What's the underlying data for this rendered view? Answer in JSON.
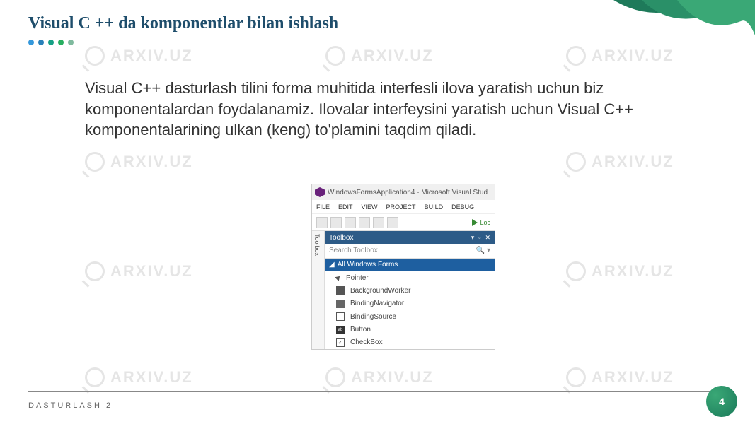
{
  "watermark_text": "ARXIV.UZ",
  "title": "Visual C ++ da komponentlar bilan ishlash",
  "body": "Visual C++ dasturlash tilini forma muhitida interfesli ilova yaratish uchun biz komponentalardan foydalanamiz. Ilovalar interfeysini yaratish uchun Visual C++  komponentalarining ulkan (keng) to'plamini taqdim qiladi.",
  "vs": {
    "window_title": "WindowsFormsApplication4 - Microsoft Visual Stud",
    "menubar": {
      "file": "FILE",
      "edit": "EDIT",
      "view": "VIEW",
      "project": "PROJECT",
      "build": "BUILD",
      "debug": "DEBUG"
    },
    "toolbar": {
      "start": "Loc"
    },
    "toolbox_tab": "Toolbox",
    "toolbox_header": "Toolbox",
    "search_placeholder": "Search Toolbox",
    "section": "All Windows Forms",
    "items": {
      "pointer": "Pointer",
      "backgroundworker": "BackgroundWorker",
      "bindingnavigator": "BindingNavigator",
      "bindingsource": "BindingSource",
      "button": "Button",
      "checkbox": "CheckBox"
    }
  },
  "footer": "DASTURLASH 2",
  "page_number": "4"
}
